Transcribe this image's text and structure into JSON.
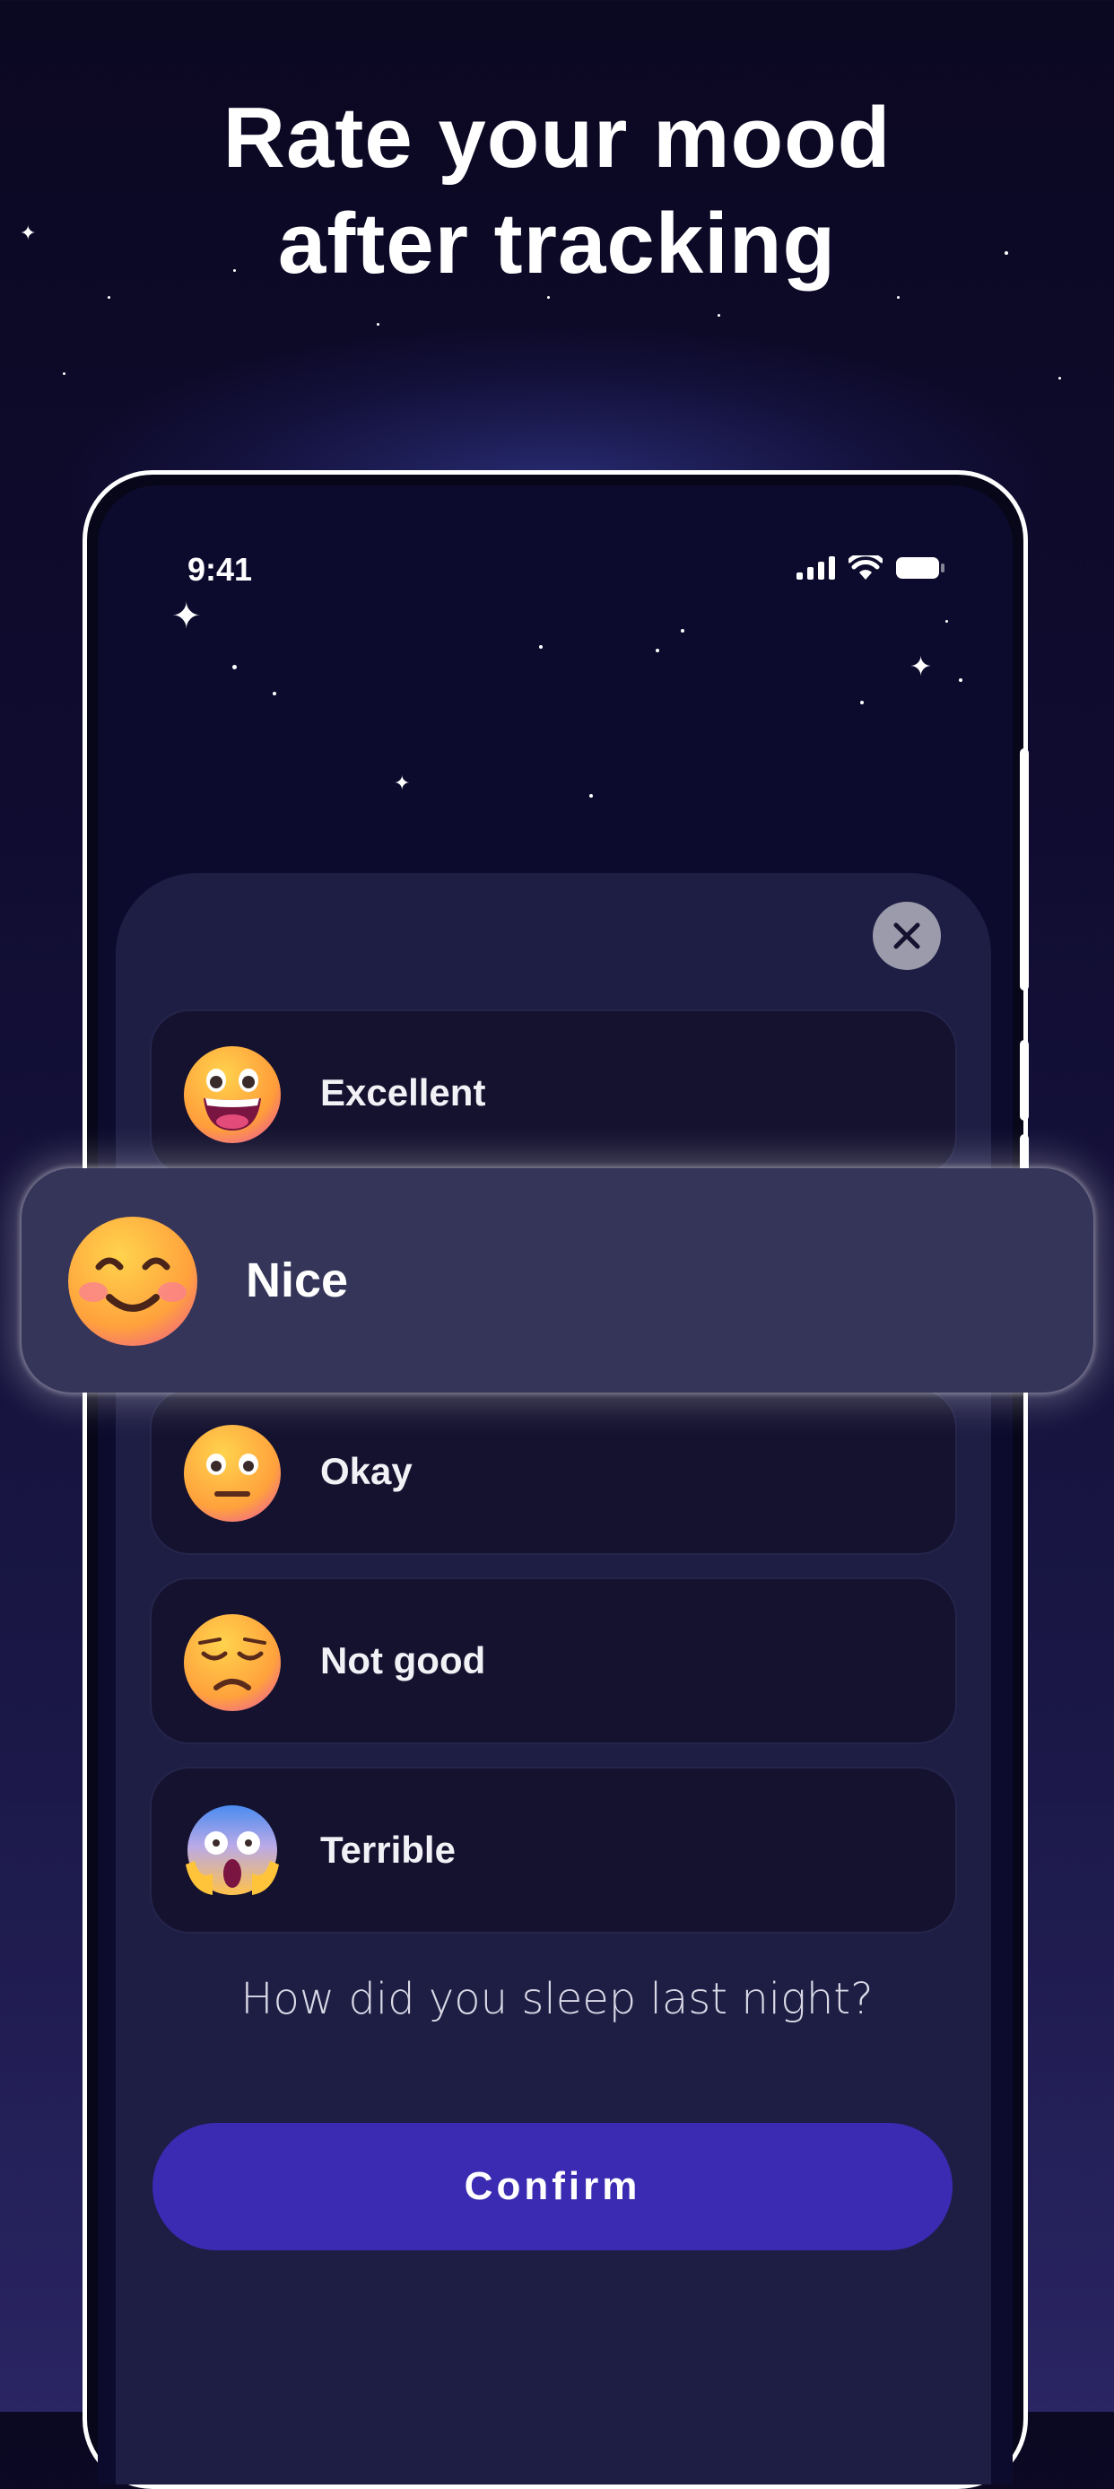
{
  "headline": {
    "line1": "Rate your mood",
    "line2": "after tracking"
  },
  "status_bar": {
    "time": "9:41"
  },
  "colors": {
    "accent": "#3a2bb2",
    "sheet": "#1e1d44",
    "selected": "#35355a"
  },
  "mood_options": [
    {
      "label": "Excellent",
      "icon": "grinning-face-icon"
    },
    {
      "label": "Nice",
      "icon": "smiling-face-icon",
      "selected": true
    },
    {
      "label": "Okay",
      "icon": "neutral-face-icon"
    },
    {
      "label": "Not good",
      "icon": "sad-face-icon"
    },
    {
      "label": "Terrible",
      "icon": "screaming-face-icon"
    }
  ],
  "prompt": "How did you sleep last night?",
  "confirm_label": "Confirm"
}
